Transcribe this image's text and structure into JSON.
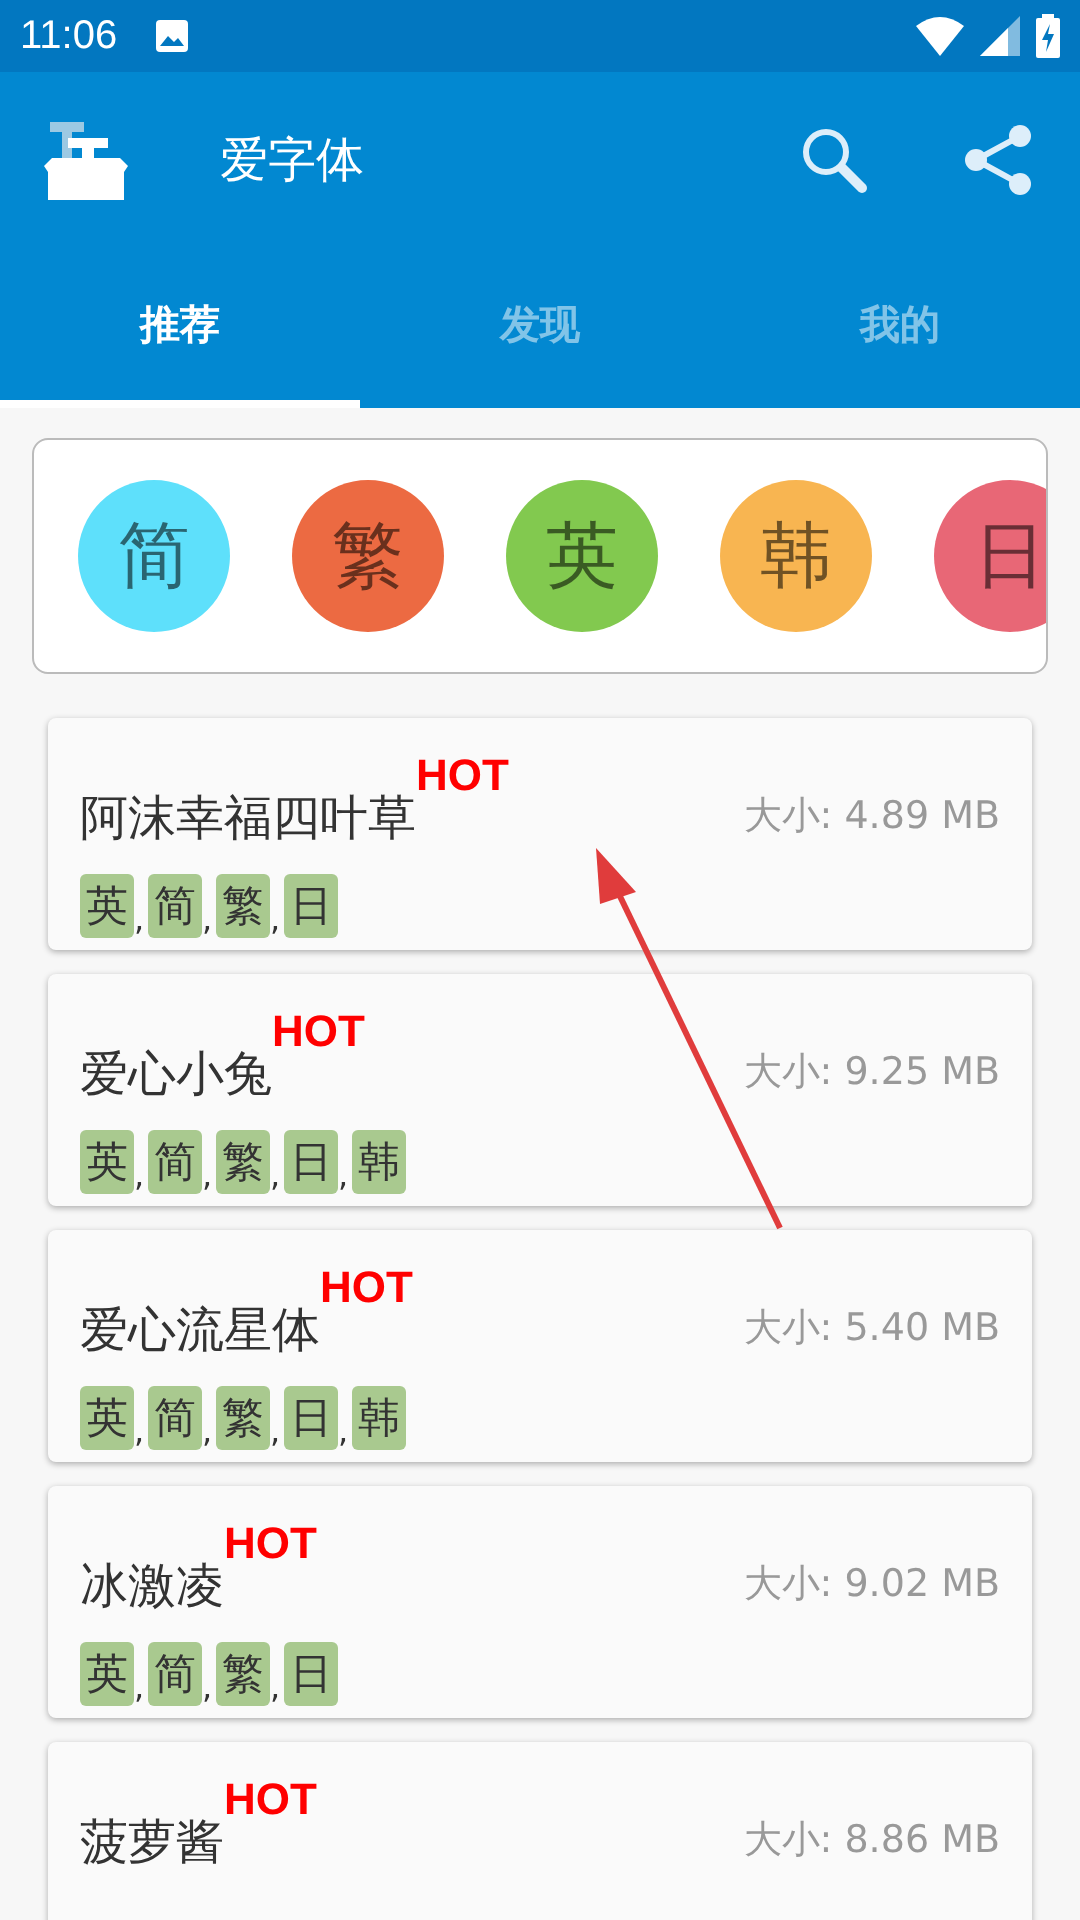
{
  "status_bar": {
    "time": "11:06"
  },
  "app_bar": {
    "title": "爱字体"
  },
  "tabs": [
    {
      "label": "推荐",
      "selected": true
    },
    {
      "label": "发现",
      "selected": false
    },
    {
      "label": "我的",
      "selected": false
    }
  ],
  "languages": [
    {
      "label": "简",
      "color": "#5ee0fb"
    },
    {
      "label": "繁",
      "color": "#ec6a42"
    },
    {
      "label": "英",
      "color": "#82c94f"
    },
    {
      "label": "韩",
      "color": "#f8b551"
    },
    {
      "label": "日",
      "color": "#e86776"
    }
  ],
  "fonts": [
    {
      "name": "阿沫幸福四叶草",
      "badge": "HOT",
      "size": "大小: 4.89 MB",
      "tags": [
        "英",
        "简",
        "繁",
        "日"
      ],
      "separator": ","
    },
    {
      "name": "爱心小兔",
      "badge": "HOT",
      "size": "大小: 9.25 MB",
      "tags": [
        "英",
        "简",
        "繁",
        "日",
        "韩"
      ],
      "separator": ","
    },
    {
      "name": "爱心流星体",
      "badge": "HOT",
      "size": "大小: 5.40 MB",
      "tags": [
        "英",
        "简",
        "繁",
        "日",
        "韩"
      ],
      "separator": ","
    },
    {
      "name": "冰激凌",
      "badge": "HOT",
      "size": "大小: 9.02 MB",
      "tags": [
        "英",
        "简",
        "繁",
        "日"
      ],
      "separator": ","
    },
    {
      "name": "菠萝酱",
      "badge": "HOT",
      "size": "大小: 8.86 MB"
    }
  ]
}
